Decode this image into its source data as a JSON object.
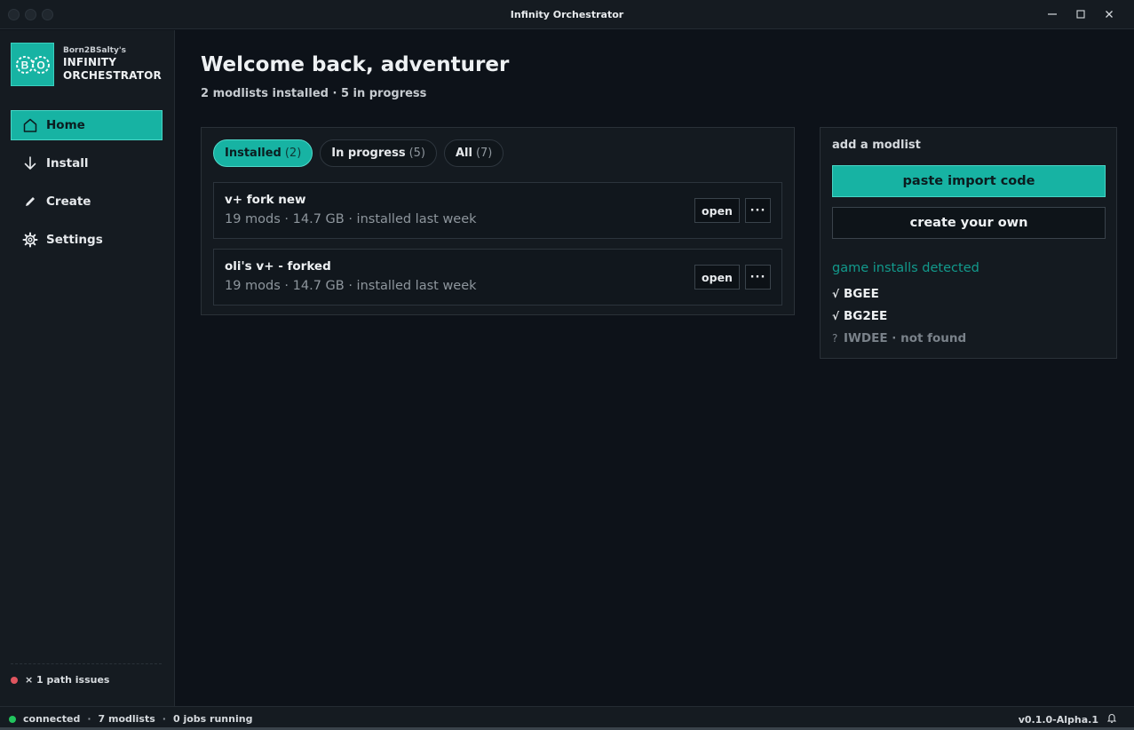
{
  "window": {
    "title": "Infinity Orchestrator",
    "controls": [
      "minimize-icon",
      "maximize-icon",
      "close-icon"
    ]
  },
  "brand": {
    "small": "Born2BSalty's",
    "line1": "INFINITY",
    "line2": "ORCHESTRATOR",
    "logo_letters": [
      "B",
      "O"
    ]
  },
  "sidebar": {
    "items": [
      {
        "label": "Home",
        "icon": "home-icon",
        "active": true
      },
      {
        "label": "Install",
        "icon": "arrow-down-icon",
        "active": false
      },
      {
        "label": "Create",
        "icon": "pencil-icon",
        "active": false
      },
      {
        "label": "Settings",
        "icon": "gear-icon",
        "active": false
      }
    ],
    "path_issues": "× 1 path issues"
  },
  "main": {
    "heading": "Welcome back, adventurer",
    "subheading": "2 modlists installed · 5 in progress",
    "tabs": [
      {
        "label": "Installed",
        "count": "(2)",
        "active": true
      },
      {
        "label": "In progress",
        "count": "(5)",
        "active": false
      },
      {
        "label": "All",
        "count": "(7)",
        "active": false
      }
    ],
    "modlists": [
      {
        "name": "v+ fork new",
        "meta": "19 mods · 14.7 GB · installed last week",
        "open_label": "open",
        "more_label": "···"
      },
      {
        "name": "oli's v+ - forked",
        "meta": "19 mods · 14.7 GB · installed last week",
        "open_label": "open",
        "more_label": "···"
      }
    ]
  },
  "add_panel": {
    "label": "add a modlist",
    "paste_label": "paste import code",
    "create_label": "create your own",
    "detected_label": "game installs detected",
    "games": [
      {
        "mark": "√",
        "name": "BGEE",
        "found": true
      },
      {
        "mark": "√",
        "name": "BG2EE",
        "found": true
      },
      {
        "mark": "?",
        "name": "IWDEE · not found",
        "found": false
      }
    ]
  },
  "statusbar": {
    "connection": "connected",
    "modlists": "7 modlists",
    "jobs": "0 jobs running",
    "separator": "·",
    "version": "v0.1.0-Alpha.1"
  },
  "colors": {
    "accent": "#17b3a3",
    "connected": "#22c55e",
    "issue": "#e0555f"
  }
}
